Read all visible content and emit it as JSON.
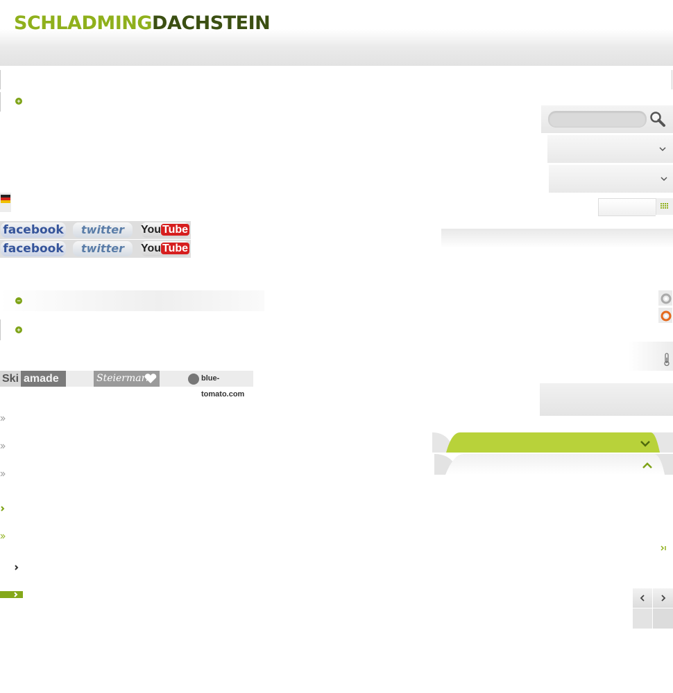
{
  "header": {
    "logo_part1": "SCHLADMING",
    "logo_part2": "DACHSTEIN"
  },
  "social": {
    "facebook_label": "facebook",
    "twitter_label": "twitter",
    "youtube_label_you": "You",
    "youtube_label_tube": "Tube"
  },
  "partners": {
    "skiamade_ski": "Ski",
    "skiamade_amade": "amade",
    "steiermark": "Steiermark",
    "bluetomato": "blue-tomato.com"
  },
  "colors": {
    "brand_green": "#8fb01c",
    "dark_green": "#3b4f12",
    "tab_green": "#b8d23a"
  },
  "icons": [
    "plus-icon",
    "minus-icon",
    "search-icon",
    "chevron-down-icon",
    "flag-icon",
    "grid-icon",
    "ring-icon",
    "thermometer-icon",
    "double-arrow-icon",
    "chevron-up-icon",
    "chevron-left-icon",
    "chevron-right-icon"
  ]
}
